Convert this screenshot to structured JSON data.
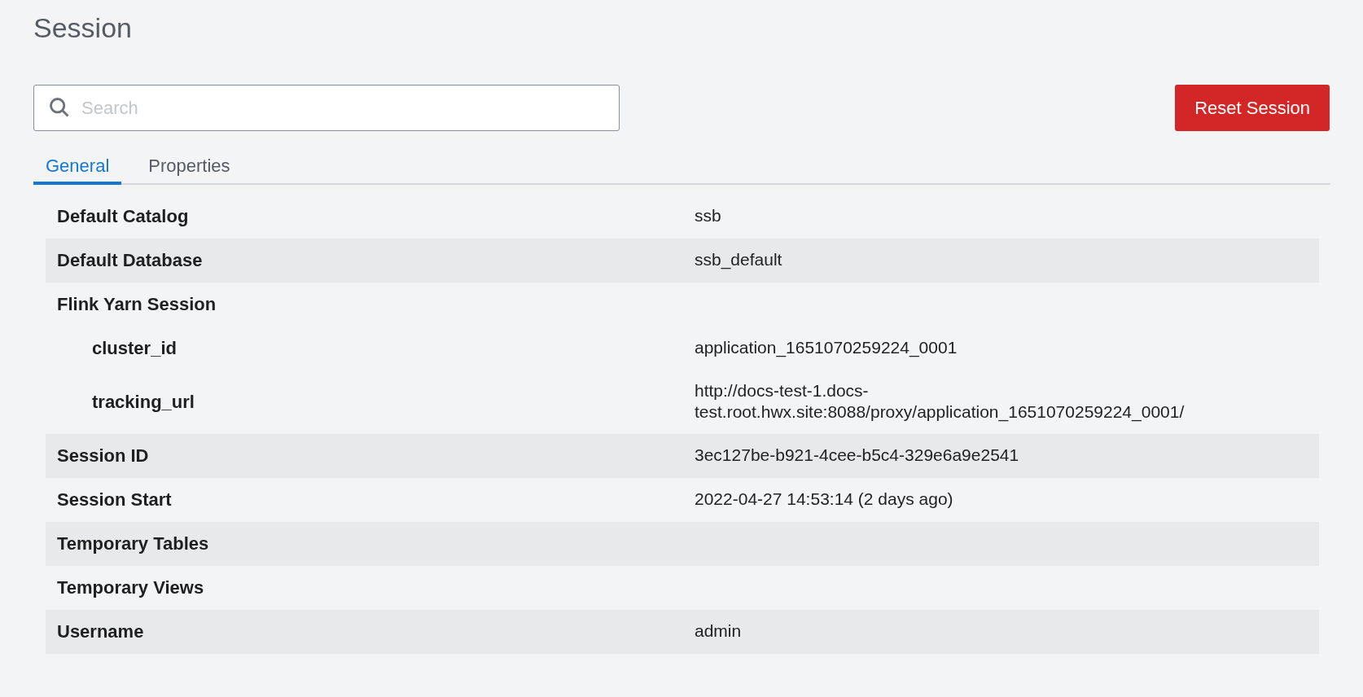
{
  "title": "Session",
  "search": {
    "placeholder": "Search"
  },
  "reset_button": "Reset Session",
  "tabs": [
    {
      "label": "General",
      "selected": true
    },
    {
      "label": "Properties",
      "selected": false
    }
  ],
  "rows": [
    {
      "label": "Default Catalog",
      "value": "ssb"
    },
    {
      "label": "Default Database",
      "value": "ssb_default"
    },
    {
      "label": "Flink Yarn Session",
      "children": [
        {
          "label": "cluster_id",
          "value": "application_1651070259224_0001"
        },
        {
          "label": "tracking_url",
          "value": "http://docs-test-1.docs-test.root.hwx.site:8088/proxy/application_1651070259224_0001/"
        }
      ]
    },
    {
      "label": "Session ID",
      "value": "3ec127be-b921-4cee-b5c4-329e6a9e2541"
    },
    {
      "label": "Session Start",
      "value": "2022-04-27 14:53:14 (2 days ago)"
    },
    {
      "label": "Temporary Tables"
    },
    {
      "label": "Temporary Views"
    },
    {
      "label": "Username",
      "value": "admin"
    }
  ]
}
